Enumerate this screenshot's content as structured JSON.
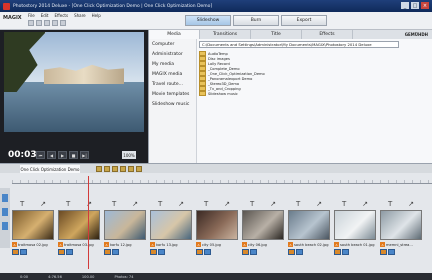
{
  "window": {
    "title": "Photostory 2014 Deluxe - [One Click Optimization Demo | One Click Optimization Demo]"
  },
  "menu": {
    "logo": "MAGIX",
    "items": [
      "File",
      "Edit",
      "Effects",
      "Share",
      "Help"
    ]
  },
  "toolbar": {
    "modes": [
      "Slideshow",
      "Burn",
      "Export"
    ]
  },
  "preview": {
    "timecode": "00:03",
    "zoom": "100%"
  },
  "media_tabs": [
    "Media",
    "Transitions",
    "Title",
    "Effects"
  ],
  "brand_label": "GEMÜHDH",
  "sidebar": [
    "Computer",
    "Administrator",
    "My media",
    "MAGIX media",
    "Travel route...",
    "Movie templates",
    "Slideshow music"
  ],
  "path": "C:\\Documents and Settings\\Administrator\\My Documents\\MAGIX\\Photostory 2014 Deluxe",
  "files": [
    "AudioTemp",
    "Disc images",
    "Lolly Record",
    "_Complete_Demo",
    "_One_Click_Optimization_Demo",
    "_Panoramalexport Demo",
    "_Stereo3D_Demo",
    "_Tv_and_Cropping",
    "Slideshow music"
  ],
  "storyboard": {
    "tab": "One Click Optimization Demo",
    "clips": [
      {
        "label": "traitmosa 02.jpg",
        "colors": [
          "#7a5a2c",
          "#d6b070",
          "#3a2b18"
        ]
      },
      {
        "label": "traitmosa 03.jpg",
        "colors": [
          "#6a4a24",
          "#cfa65e",
          "#2c2010"
        ]
      },
      {
        "label": "korfu 12.jpg",
        "colors": [
          "#9db8d6",
          "#c9b79a",
          "#3e5a72"
        ]
      },
      {
        "label": "korfu 13.jpg",
        "colors": [
          "#a9c0da",
          "#d7c6a8",
          "#48667e"
        ]
      },
      {
        "label": "city 05.jpg",
        "colors": [
          "#3b2a24",
          "#8a6a58",
          "#cbb4a0"
        ]
      },
      {
        "label": "city 06.jpg",
        "colors": [
          "#5a5550",
          "#b8b0a6",
          "#2a2622"
        ]
      },
      {
        "label": "south beach 02.jpg",
        "colors": [
          "#6a7c8c",
          "#b7c4cf",
          "#4a5560"
        ]
      },
      {
        "label": "south beach 01.jpg",
        "colors": [
          "#c9d2d8",
          "#f1f3f4",
          "#7b8a94"
        ]
      },
      {
        "label": "memni_strea...",
        "colors": [
          "#8d9aa4",
          "#dfe4e8",
          "#5e6b74"
        ]
      }
    ]
  },
  "statusbar": {
    "left": "0:00",
    "mid": "4:76.56",
    "right": "100.00",
    "photos": "Photos: 74"
  }
}
